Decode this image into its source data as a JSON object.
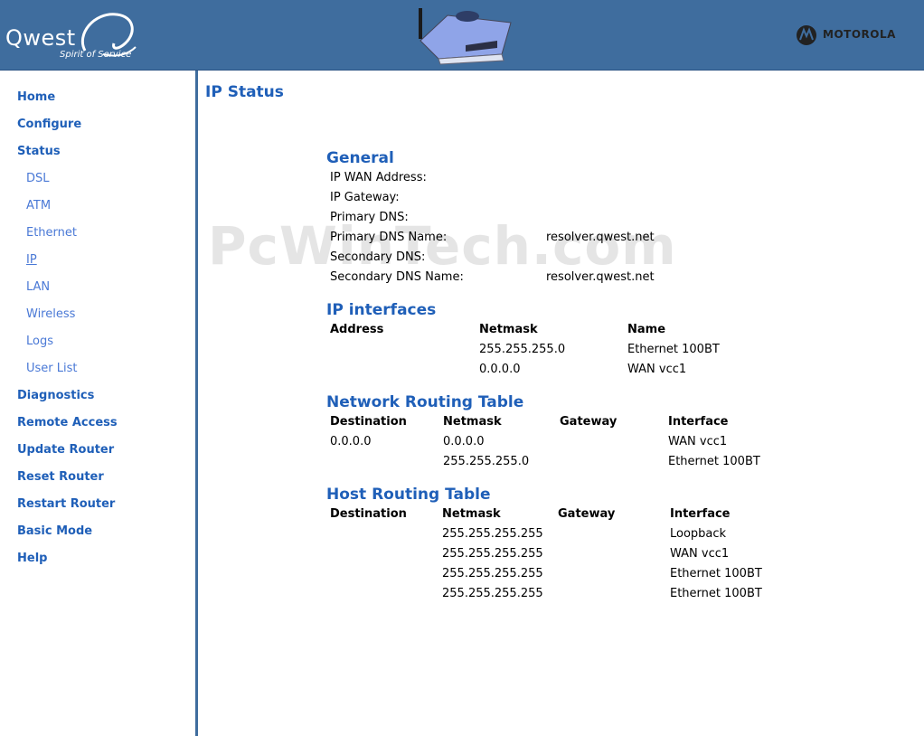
{
  "header": {
    "brand": "Qwest",
    "tagline": "Spirit of Service",
    "vendor": "MOTOROLA"
  },
  "sidebar": {
    "items": [
      {
        "label": "Home"
      },
      {
        "label": "Configure"
      },
      {
        "label": "Status"
      },
      {
        "label": "DSL"
      },
      {
        "label": "ATM"
      },
      {
        "label": "Ethernet"
      },
      {
        "label": "IP"
      },
      {
        "label": "LAN"
      },
      {
        "label": "Wireless"
      },
      {
        "label": "Logs"
      },
      {
        "label": "User List"
      },
      {
        "label": "Diagnostics"
      },
      {
        "label": "Remote Access"
      },
      {
        "label": "Update Router"
      },
      {
        "label": "Reset Router"
      },
      {
        "label": "Restart Router"
      },
      {
        "label": "Basic Mode"
      },
      {
        "label": "Help"
      }
    ]
  },
  "page": {
    "title": "IP Status",
    "watermark": "PcWinTech.com"
  },
  "general": {
    "title": "General",
    "rows": [
      {
        "label": "IP WAN Address:",
        "value": ""
      },
      {
        "label": "IP Gateway:",
        "value": ""
      },
      {
        "label": "Primary DNS:",
        "value": ""
      },
      {
        "label": "Primary DNS Name:",
        "value": "resolver.qwest.net"
      },
      {
        "label": "Secondary DNS:",
        "value": ""
      },
      {
        "label": "Secondary DNS Name:",
        "value": "resolver.qwest.net"
      }
    ]
  },
  "ip_interfaces": {
    "title": "IP interfaces",
    "headers": [
      "Address",
      "Netmask",
      "Name"
    ],
    "rows": [
      [
        "",
        "255.255.255.0",
        "Ethernet 100BT"
      ],
      [
        "",
        "0.0.0.0",
        "WAN vcc1"
      ]
    ]
  },
  "network_routing": {
    "title": "Network Routing Table",
    "headers": [
      "Destination",
      "Netmask",
      "Gateway",
      "Interface"
    ],
    "rows": [
      [
        "0.0.0.0",
        "0.0.0.0",
        "",
        "WAN vcc1"
      ],
      [
        "",
        "255.255.255.0",
        "",
        "Ethernet 100BT"
      ]
    ]
  },
  "host_routing": {
    "title": "Host Routing Table",
    "headers": [
      "Destination",
      "Netmask",
      "Gateway",
      "Interface"
    ],
    "rows": [
      [
        "",
        "255.255.255.255",
        "",
        "Loopback"
      ],
      [
        "",
        "255.255.255.255",
        "",
        "WAN vcc1"
      ],
      [
        "",
        "255.255.255.255",
        "",
        "Ethernet 100BT"
      ],
      [
        "",
        "255.255.255.255",
        "",
        "Ethernet 100BT"
      ]
    ]
  }
}
